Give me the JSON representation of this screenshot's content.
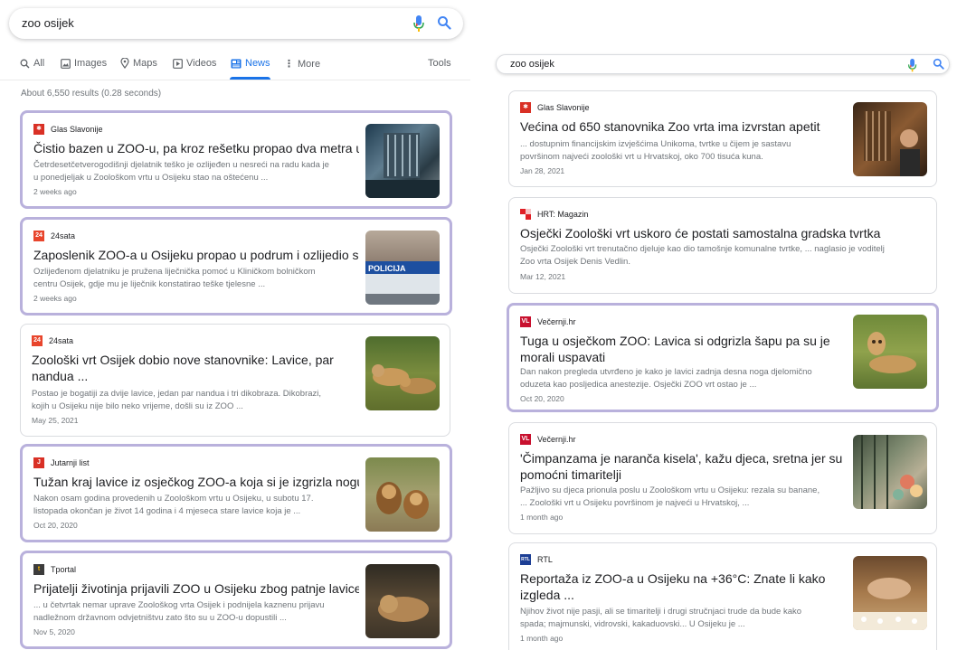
{
  "query": "zoo osijek",
  "tabs": [
    {
      "label": "All",
      "icon": "search-icon"
    },
    {
      "label": "Images",
      "icon": "image-icon"
    },
    {
      "label": "Maps",
      "icon": "map-pin-icon"
    },
    {
      "label": "Videos",
      "icon": "video-icon"
    },
    {
      "label": "News",
      "icon": "news-icon",
      "active": true
    },
    {
      "label": "More",
      "icon": "more-icon"
    }
  ],
  "tools_label": "Tools",
  "result_stats": "About 6,550 results (0.28 seconds)",
  "colors": {
    "accent": "#1a73e8",
    "highlight_border": "#b9b1dc",
    "snippet": "#70757a"
  },
  "left_results": [
    {
      "source": "Glas Slavonije",
      "logo_color": "#d93025",
      "title": "Čistio bazen u ZOO-u, pa kroz rešetku propao dva metra u ...",
      "snippet1": "Četrdesetčetverogodišnji djelatnik teško je ozlijeđen u nesreći na radu kada je",
      "snippet2": "u ponedjeljak u Zoološkom vrtu u Osijeku stao na oštećenu ...",
      "date": "2 weeks ago"
    },
    {
      "source": "24sata",
      "logo_color": "#e8452c",
      "title": "Zaposlenik ZOO-a u Osijeku propao u podrum i ozlijedio se",
      "snippet1": "Ozlijeđenom djelatniku je pružena liječnička pomoć u Kliničkom bolničkom",
      "snippet2": "centru Osijek, gdje mu je liječnik konstatirao teške tjelesne ...",
      "date": "2 weeks ago"
    },
    {
      "source": "24sata",
      "logo_color": "#e8452c",
      "title1": "Zoološki vrt Osijek dobio nove stanovnike: Lavice, par",
      "title2": "nandua ...",
      "snippet1": "Postao je bogatiji za dvije lavice, jedan par nandua i tri dikobraza. Dikobrazi,",
      "snippet2": "kojih u Osijeku nije bilo neko vrijeme, došli su iz ZOO ...",
      "date": "May 25, 2021"
    },
    {
      "source": "Jutarnji list",
      "logo_color": "#d93025",
      "title": "Tužan kraj lavice iz osječkog ZOO-a koja si je izgrizla nogu ...",
      "snippet1": "Nakon osam godina provedenih u Zoološkom vrtu u Osijeku, u subotu 17.",
      "snippet2": "listopada okončan je život 14 godina i 4 mjeseca stare lavice koja je ...",
      "date": "Oct 20, 2020"
    },
    {
      "source": "Tportal",
      "logo_color": "#3c3c3c",
      "title": "Prijatelji životinja prijavili ZOO u Osijeku zbog patnje lavice",
      "snippet1": "... u četvrtak nemar uprave Zoološkog vrta Osijek i podnijela kaznenu prijavu",
      "snippet2": "nadležnom državnom odvjetništvu zato što su u ZOO-u dopustili ...",
      "date": "Nov 5, 2020"
    }
  ],
  "right_results": [
    {
      "source": "Glas Slavonije",
      "logo_color": "#d93025",
      "title": "Većina od 650 stanovnika Zoo vrta ima izvrstan apetit",
      "snippet1": "... dostupnim financijskim izvješćima Unikoma, tvrtke u čijem je sastavu",
      "snippet2": "površinom najveći zoološki vrt u Hrvatskoj, oko 700 tisuća kuna.",
      "date": "Jan 28, 2021"
    },
    {
      "source": "HRT: Magazin",
      "logo_color": "#e01f26",
      "title": "Osječki Zoološki vrt uskoro će postati samostalna gradska tvrtka",
      "snippet1": "Osječki Zoološki vrt trenutačno djeluje kao dio tamošnje komunalne tvrtke, ... naglasio je voditelj",
      "snippet2": "Zoo vrta Osijek Denis Vedlin.",
      "date": "Mar 12, 2021"
    },
    {
      "source": "Večernji.hr",
      "logo_color": "#c8102e",
      "logo_text": "VL",
      "title1": "Tuga u osječkom ZOO: Lavica si odgrizla šapu pa su je",
      "title2": "morali uspavati",
      "snippet1": "Dan nakon pregleda utvrđeno je kako je lavici zadnja desna noga djelomično",
      "snippet2": "oduzeta kao posljedica anestezije. Osječki ZOO vrt ostao je ...",
      "date": "Oct 20, 2020"
    },
    {
      "source": "Večernji.hr",
      "logo_color": "#c8102e",
      "logo_text": "VL",
      "title1": "'Čimpanzama je naranča kisela', kažu djeca, sretna jer su",
      "title2": "pomoćni timaritelji",
      "snippet1": "Pažljivo su djeca prionula poslu u Zoološkom vrtu u Osijeku: rezala su banane,",
      "snippet2": "... Zoološki vrt u Osijeku površinom je najveći u Hrvatskoj, ...",
      "date": "1 month ago"
    },
    {
      "source": "RTL",
      "logo_color": "#1d3f95",
      "title1": "Reportaža iz ZOO-a u Osijeku na +36°C: Znate li kako",
      "title2": "izgleda ...",
      "snippet1": "Njihov život nije pasji, ali se timaritelji i drugi stručnjaci trude da bude kako",
      "snippet2": "spada; majmunski, vidrovski, kakaduovski... U Osijeku je ...",
      "date": "1 month ago"
    }
  ]
}
